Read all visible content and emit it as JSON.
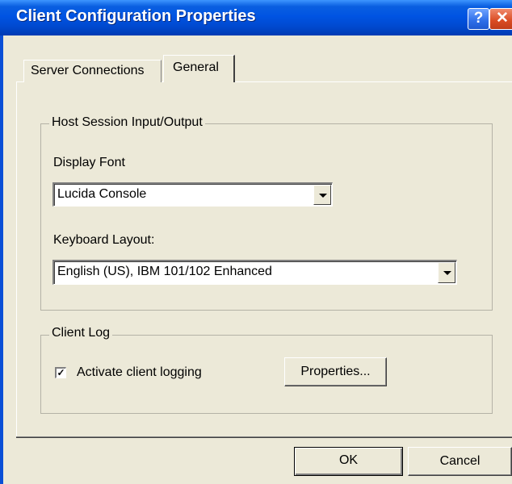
{
  "window": {
    "title": "Client Configuration Properties",
    "help_symbol": "?",
    "close_symbol": "✕"
  },
  "tabs": [
    {
      "label": "Server Connections",
      "selected": false
    },
    {
      "label": "General",
      "selected": true
    }
  ],
  "host_group": {
    "label": "Host Session Input/Output",
    "display_font_label": "Display Font",
    "display_font_value": "Lucida Console",
    "keyboard_label": "Keyboard Layout:",
    "keyboard_value": "English (US), IBM 101/102 Enhanced"
  },
  "log_group": {
    "label": "Client Log",
    "checkbox_label": "Activate client logging",
    "checkbox_checked": true,
    "check_mark": "✓",
    "properties_button": "Properties..."
  },
  "footer": {
    "ok_label": "OK",
    "cancel_label": "Cancel"
  },
  "colors": {
    "titlebar": "#0054e3",
    "face": "#ece9d8"
  }
}
